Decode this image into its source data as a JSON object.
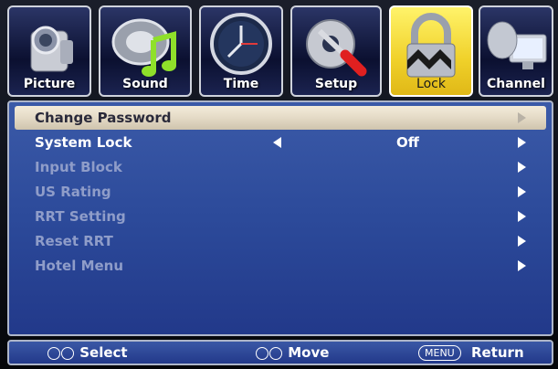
{
  "tabs": [
    {
      "label": "Picture",
      "icon": "camera-icon",
      "active": false
    },
    {
      "label": "Sound",
      "icon": "music-note-icon",
      "active": false
    },
    {
      "label": "Time",
      "icon": "clock-icon",
      "active": false
    },
    {
      "label": "Setup",
      "icon": "screwdriver-icon",
      "active": false
    },
    {
      "label": "Lock",
      "icon": "padlock-icon",
      "active": true
    },
    {
      "label": "Channel",
      "icon": "satellite-dish-icon",
      "active": false
    }
  ],
  "menu": {
    "items": [
      {
        "label": "Change Password",
        "state": "selected"
      },
      {
        "label": "System Lock",
        "state": "enabled",
        "value": "Off"
      },
      {
        "label": "Input Block",
        "state": "disabled"
      },
      {
        "label": "US Rating",
        "state": "disabled"
      },
      {
        "label": "RRT Setting",
        "state": "disabled"
      },
      {
        "label": "Reset RRT",
        "state": "disabled"
      },
      {
        "label": "Hotel Menu",
        "state": "disabled"
      }
    ]
  },
  "footer": {
    "select_label": "Select",
    "move_label": "Move",
    "menu_key": "MENU",
    "return_label": "Return"
  },
  "colors": {
    "panel": "#2c4a9a",
    "active_tab": "#f0d12a",
    "selected_row": "#e4dac6",
    "disabled_text": "#8f9dc9"
  }
}
